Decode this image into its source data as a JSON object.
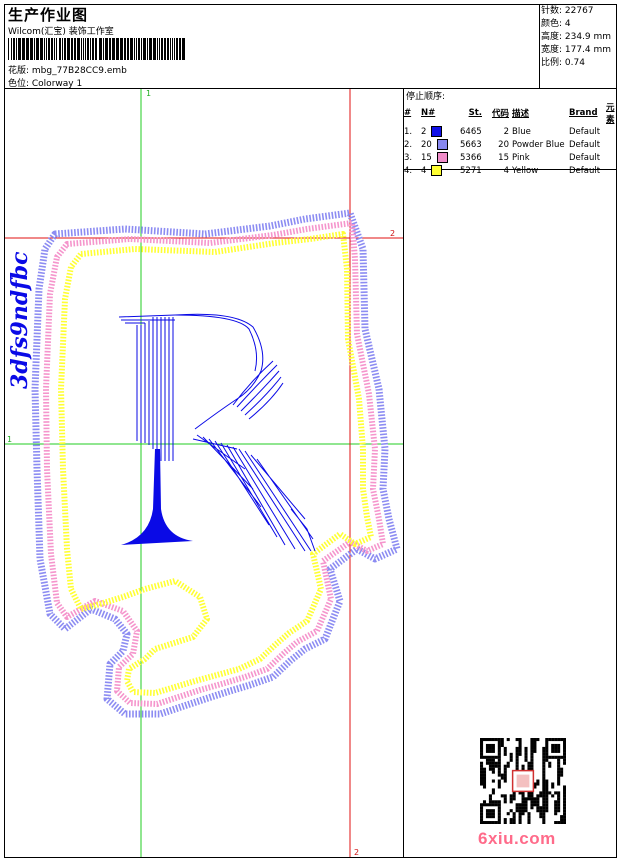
{
  "header": {
    "title": "生产作业图",
    "subtitle": "Wilcom(汇宝) 装饰工作室",
    "design_label": "花版: mbg_77B28CC9.emb",
    "colorway_label": "色位: Colorway 1"
  },
  "stats": {
    "stitches": "针数: 22767",
    "colors": "颜色: 4",
    "height": "高度: 234.9 mm",
    "width": "宽度: 177.4 mm",
    "scale": "比例: 0.74"
  },
  "stop_sequence": {
    "title": "停止顺序:",
    "headers": [
      "#",
      "N#",
      "St.",
      "代码",
      "描述",
      "Brand",
      "元素"
    ],
    "rows": [
      {
        "idx": "1.",
        "n": "2",
        "st": "6465",
        "code": "2",
        "desc": "Blue",
        "brand": "Default",
        "color": "#1010e8"
      },
      {
        "idx": "2.",
        "n": "20",
        "st": "5663",
        "code": "20",
        "desc": "Powder Blue",
        "brand": "Default",
        "color": "#8888f0"
      },
      {
        "idx": "3.",
        "n": "15",
        "st": "5366",
        "code": "15",
        "desc": "Pink",
        "brand": "Default",
        "color": "#f08cc8"
      },
      {
        "idx": "4.",
        "n": "4",
        "st": "5271",
        "code": "4",
        "desc": "Yellow",
        "brand": "Default",
        "color": "#ffff33"
      }
    ]
  },
  "guides": {
    "label_1": "1",
    "label_2": "2"
  },
  "artwork": {
    "letter": "R",
    "side_text": "3dfs9ndfbc"
  },
  "watermark": {
    "logo_text": "6xiu.com"
  }
}
